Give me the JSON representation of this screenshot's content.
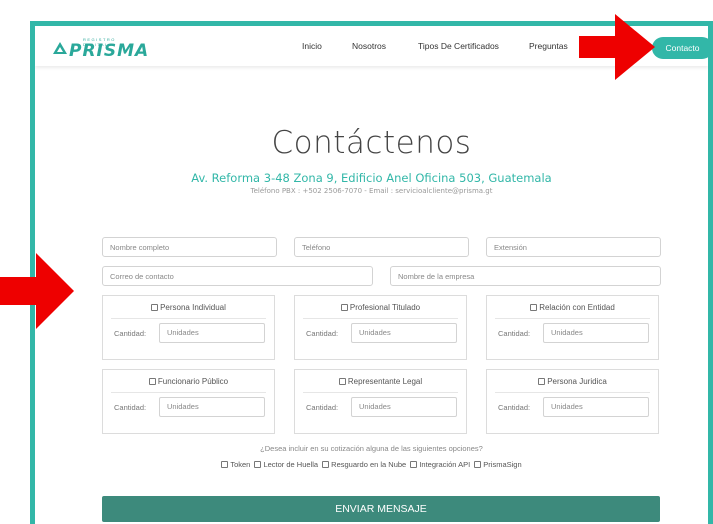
{
  "nav": {
    "logo_tag": "REGISTRO DIGITAL",
    "logo_word": "PRISMA",
    "links": [
      "Inicio",
      "Nosotros",
      "Tipos De Certificados",
      "Preguntas"
    ],
    "cta": "Contacto"
  },
  "header": {
    "title": "Contáctenos",
    "address": "Av. Reforma 3-48 Zona 9, Edificio Anel Oficina 503, Guatemala",
    "contact_line": "Teléfono PBX : +502 2506-7070 - Email : servicioalcliente@prisma.gt"
  },
  "form": {
    "name_placeholder": "Nombre completo",
    "phone_placeholder": "Teléfono",
    "extension_placeholder": "Extensión",
    "email_placeholder": "Correo de contacto",
    "company_placeholder": "Nombre de la empresa",
    "cards": [
      {
        "label": "Persona Individual",
        "qty_label": "Cantidad:",
        "qty_placeholder": "Unidades"
      },
      {
        "label": "Profesional Titulado",
        "qty_label": "Cantidad:",
        "qty_placeholder": "Unidades"
      },
      {
        "label": "Relación con Entidad",
        "qty_label": "Cantidad:",
        "qty_placeholder": "Unidades"
      },
      {
        "label": "Funcionario Público",
        "qty_label": "Cantidad:",
        "qty_placeholder": "Unidades"
      },
      {
        "label": "Representante Legal",
        "qty_label": "Cantidad:",
        "qty_placeholder": "Unidades"
      },
      {
        "label": "Persona Juridica",
        "qty_label": "Cantidad:",
        "qty_placeholder": "Unidades"
      }
    ],
    "options_question": "¿Desea incluir en su cotización alguna de las siguientes opciones?",
    "options": [
      "Token",
      "Lector de Huella",
      "Resguardo en la Nube",
      "Integración API",
      "PrismaSign"
    ],
    "submit": "ENVIAR MENSAJE"
  },
  "colors": {
    "brand_teal": "#32b7a8",
    "submit_green": "#3d8a7c",
    "annotation_red": "#ee0000"
  }
}
